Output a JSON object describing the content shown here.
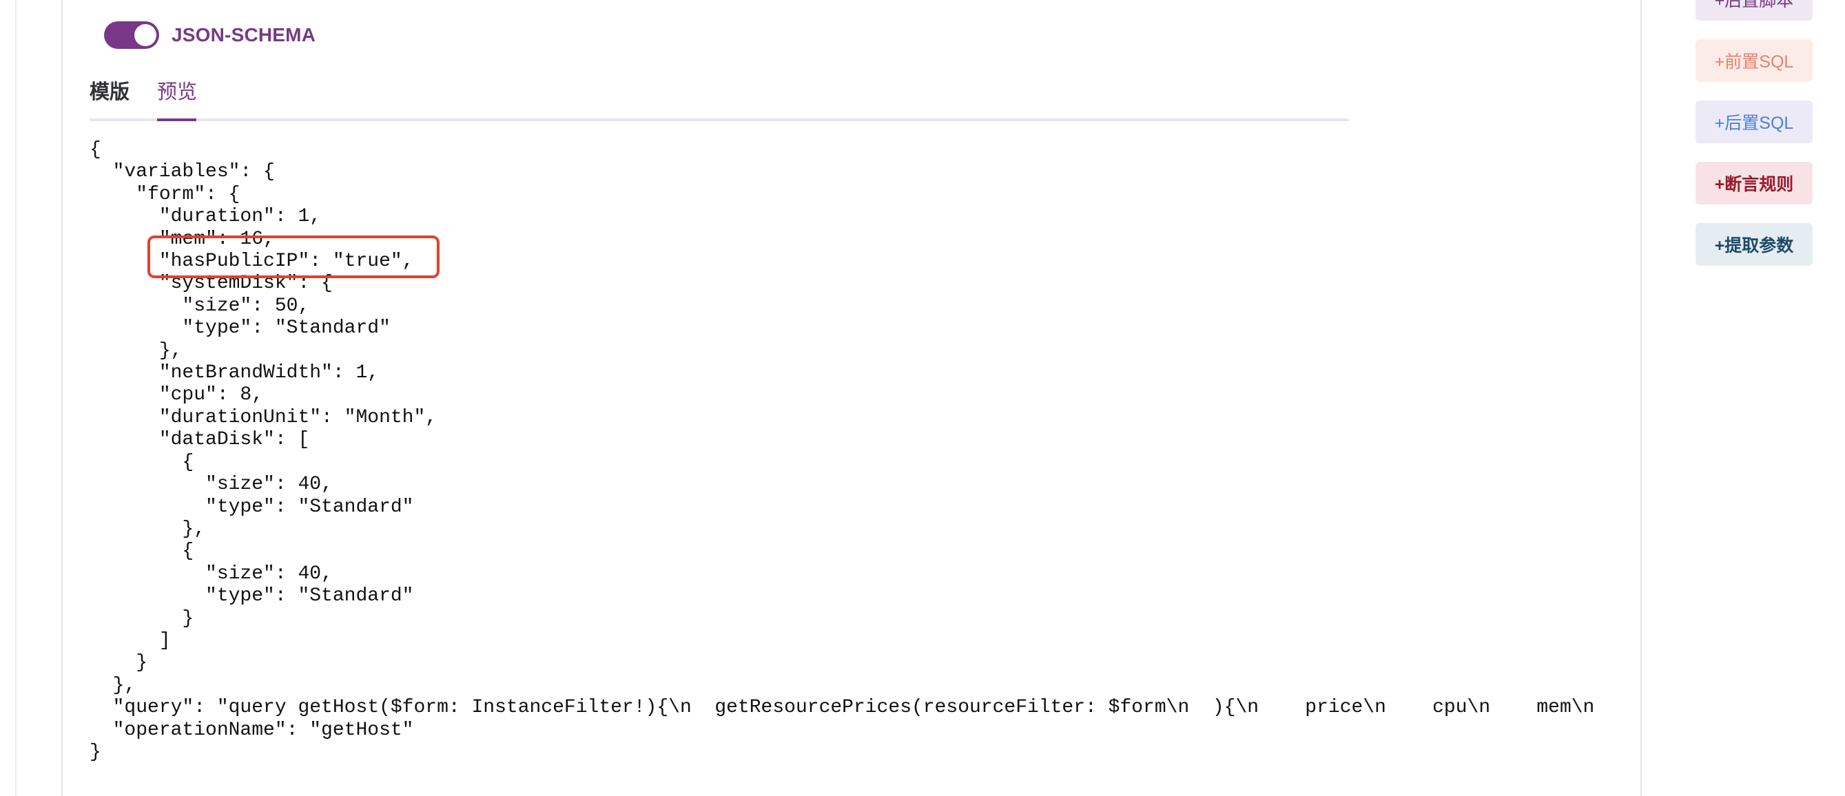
{
  "switch": {
    "label": "JSON-SCHEMA",
    "on": true,
    "color": "#783887"
  },
  "tabs": {
    "template": "模版",
    "preview": "预览",
    "active": "预览"
  },
  "code_preview": "{\n  \"variables\": {\n    \"form\": {\n      \"duration\": 1,\n      \"mem\": 16,\n      \"hasPublicIP\": \"true\",\n      \"systemDisk\": {\n        \"size\": 50,\n        \"type\": \"Standard\"\n      },\n      \"netBrandWidth\": 1,\n      \"cpu\": 8,\n      \"durationUnit\": \"Month\",\n      \"dataDisk\": [\n        {\n          \"size\": 40,\n          \"type\": \"Standard\"\n        },\n        {\n          \"size\": 40,\n          \"type\": \"Standard\"\n        }\n      ]\n    }\n  },\n  \"query\": \"query getHost($form: InstanceFilter!){\\n  getResourcePrices(resourceFilter: $form\\n  ){\\n    price\\n    cpu\\n    mem\\n\n  \"operationName\": \"getHost\"\n}",
  "highlight_color": "#e0422f",
  "side_buttons": {
    "post_script": "+后置脚本",
    "pre_sql": "+前置SQL",
    "post_sql": "+后置SQL",
    "assertion": "+断言规则",
    "extract_params": "+提取参数"
  }
}
